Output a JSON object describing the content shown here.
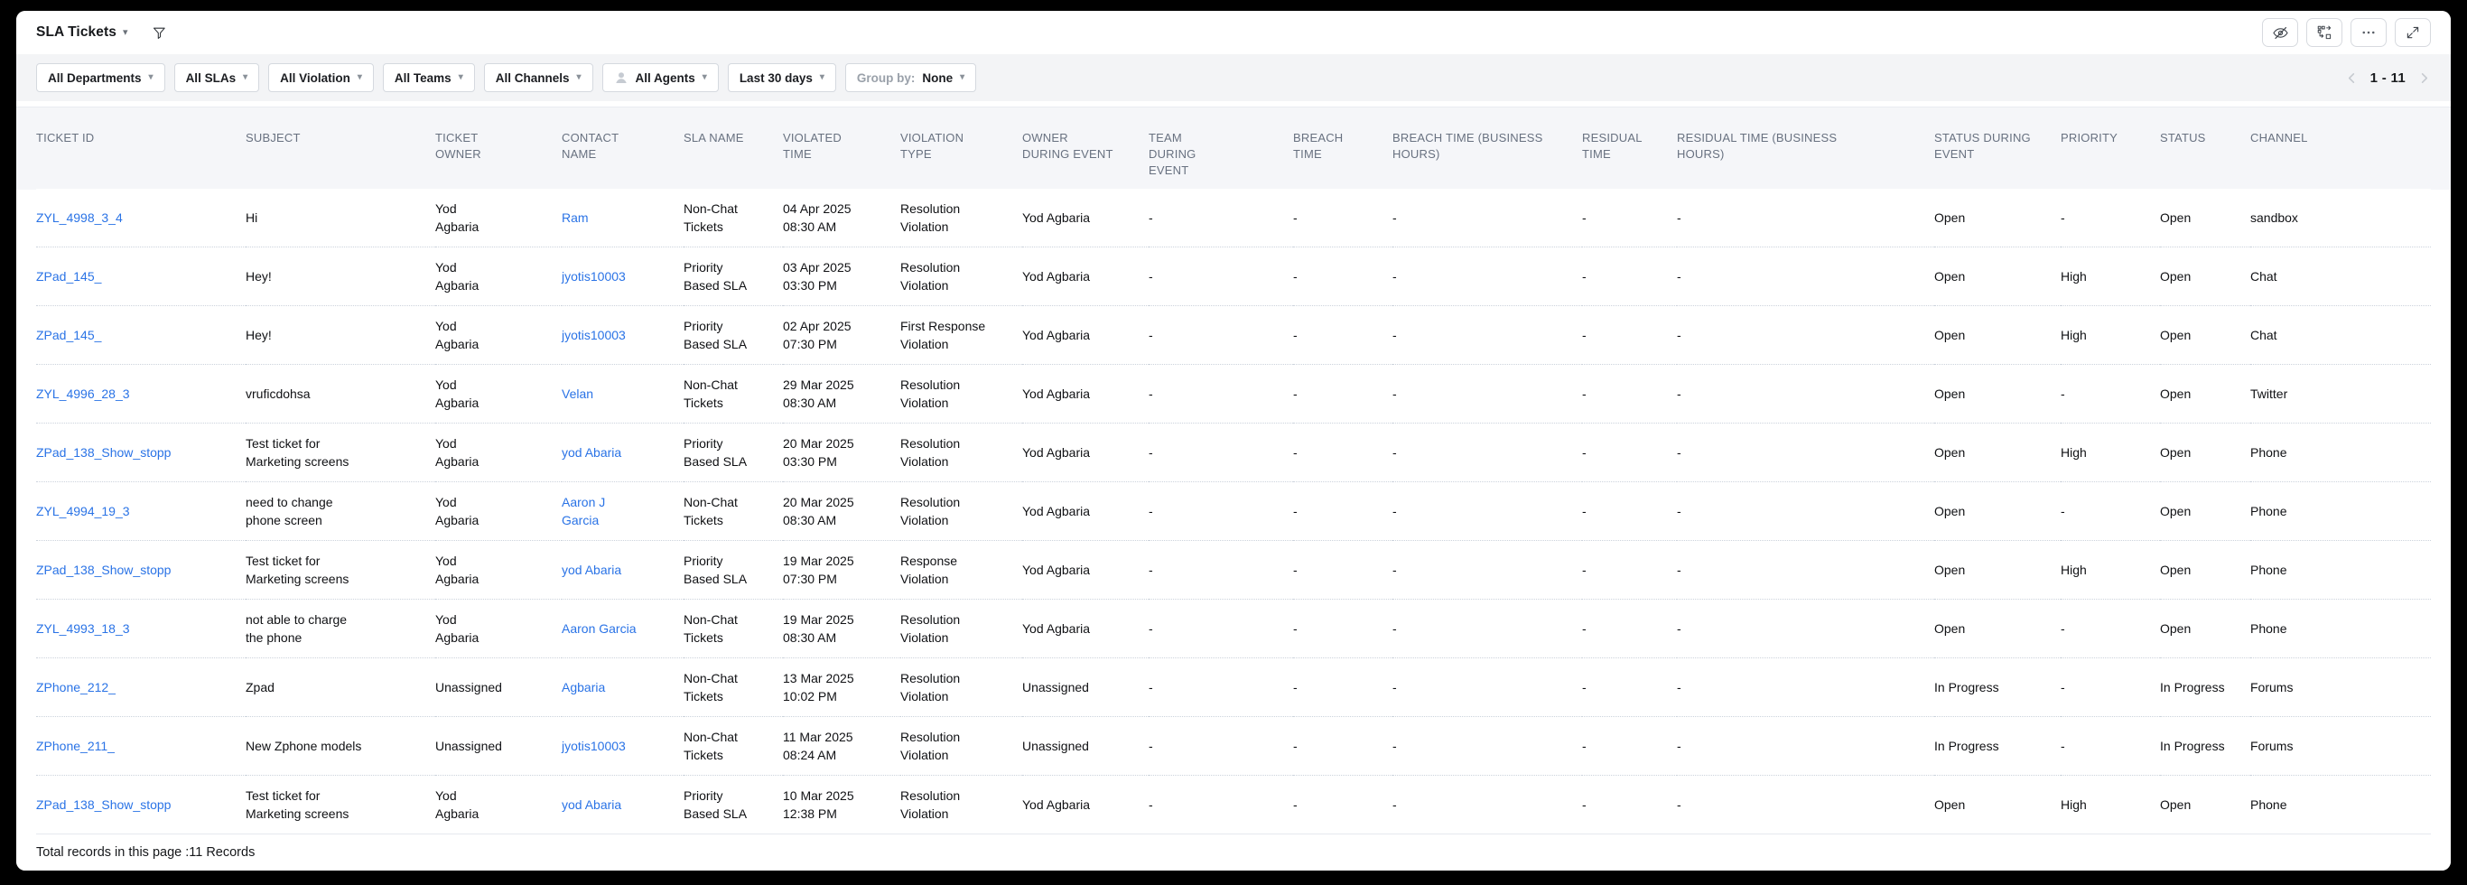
{
  "titlebar": {
    "title": "SLA Tickets"
  },
  "icons": {
    "title_caret": "caret-down-icon",
    "title_filter": "funnel-icon",
    "hide_columns": "eye-off-icon",
    "rearrange": "rearrange-columns-icon",
    "more_options": "ellipsis-icon",
    "expand": "expand-icon",
    "agents": "person-icon",
    "page_prev": "chevron-left-icon",
    "page_next": "chevron-right-icon"
  },
  "filterbar": {
    "filters": [
      {
        "label": "All Departments"
      },
      {
        "label": "All SLAs"
      },
      {
        "label": "All Violation"
      },
      {
        "label": "All Teams"
      },
      {
        "label": "All Channels"
      },
      {
        "label": "All Agents"
      },
      {
        "label": "Last 30 days"
      }
    ],
    "group_by": {
      "label": "Group by:",
      "value": "None"
    },
    "pagination": {
      "range": "1 - 11"
    }
  },
  "table": {
    "columns": [
      "TICKET ID",
      "SUBJECT",
      "TICKET OWNER",
      "CONTACT NAME",
      "SLA NAME",
      "VIOLATED TIME",
      "VIOLATION TYPE",
      "OWNER DURING EVENT",
      "TEAM DURING EVENT",
      "BREACH TIME",
      "BREACH TIME (BUSINESS HOURS)",
      "RESIDUAL TIME",
      "RESIDUAL TIME (BUSINESS HOURS)",
      "STATUS DURING EVENT",
      "PRIORITY",
      "STATUS",
      "CHANNEL"
    ],
    "rows": [
      {
        "ticket_id": "ZYL_4998_3_4",
        "subject": "Hi",
        "ticket_owner": "Yod Agbaria",
        "contact_name": "Ram",
        "sla_name": "Non-Chat Tickets",
        "violated_time": "04 Apr 2025 08:30 AM",
        "violation_type": "Resolution Violation",
        "owner_during_event": "Yod Agbaria",
        "team_during_event": "-",
        "breach_time": "-",
        "breach_time_bh": "-",
        "residual_time": "-",
        "residual_time_bh": "-",
        "status_during_event": "Open",
        "priority": "-",
        "status": "Open",
        "channel": "sandbox"
      },
      {
        "ticket_id": "ZPad_145_",
        "subject": "Hey!",
        "ticket_owner": "Yod Agbaria",
        "contact_name": "jyotis10003",
        "sla_name": "Priority Based SLA",
        "violated_time": "03 Apr 2025 03:30 PM",
        "violation_type": "Resolution Violation",
        "owner_during_event": "Yod Agbaria",
        "team_during_event": "-",
        "breach_time": "-",
        "breach_time_bh": "-",
        "residual_time": "-",
        "residual_time_bh": "-",
        "status_during_event": "Open",
        "priority": "High",
        "status": "Open",
        "channel": "Chat"
      },
      {
        "ticket_id": "ZPad_145_",
        "subject": "Hey!",
        "ticket_owner": "Yod Agbaria",
        "contact_name": "jyotis10003",
        "sla_name": "Priority Based SLA",
        "violated_time": "02 Apr 2025 07:30 PM",
        "violation_type": "First Response Violation",
        "owner_during_event": "Yod Agbaria",
        "team_during_event": "-",
        "breach_time": "-",
        "breach_time_bh": "-",
        "residual_time": "-",
        "residual_time_bh": "-",
        "status_during_event": "Open",
        "priority": "High",
        "status": "Open",
        "channel": "Chat"
      },
      {
        "ticket_id": "ZYL_4996_28_3",
        "subject": "vruficdohsa",
        "ticket_owner": "Yod Agbaria",
        "contact_name": "Velan",
        "sla_name": "Non-Chat Tickets",
        "violated_time": "29 Mar 2025 08:30 AM",
        "violation_type": "Resolution Violation",
        "owner_during_event": "Yod Agbaria",
        "team_during_event": "-",
        "breach_time": "-",
        "breach_time_bh": "-",
        "residual_time": "-",
        "residual_time_bh": "-",
        "status_during_event": "Open",
        "priority": "-",
        "status": "Open",
        "channel": "Twitter"
      },
      {
        "ticket_id": "ZPad_138_Show_stopp",
        "subject": "Test ticket for Marketing screens",
        "ticket_owner": "Yod Agbaria",
        "contact_name": "yod Abaria",
        "sla_name": "Priority Based SLA",
        "violated_time": "20 Mar 2025 03:30 PM",
        "violation_type": "Resolution Violation",
        "owner_during_event": "Yod Agbaria",
        "team_during_event": "-",
        "breach_time": "-",
        "breach_time_bh": "-",
        "residual_time": "-",
        "residual_time_bh": "-",
        "status_during_event": "Open",
        "priority": "High",
        "status": "Open",
        "channel": "Phone"
      },
      {
        "ticket_id": "ZYL_4994_19_3",
        "subject": "need to change phone screen",
        "ticket_owner": "Yod Agbaria",
        "contact_name": "Aaron J Garcia",
        "sla_name": "Non-Chat Tickets",
        "violated_time": "20 Mar 2025 08:30 AM",
        "violation_type": "Resolution Violation",
        "owner_during_event": "Yod Agbaria",
        "team_during_event": "-",
        "breach_time": "-",
        "breach_time_bh": "-",
        "residual_time": "-",
        "residual_time_bh": "-",
        "status_during_event": "Open",
        "priority": "-",
        "status": "Open",
        "channel": "Phone"
      },
      {
        "ticket_id": "ZPad_138_Show_stopp",
        "subject": "Test ticket for Marketing screens",
        "ticket_owner": "Yod Agbaria",
        "contact_name": "yod Abaria",
        "sla_name": "Priority Based SLA",
        "violated_time": "19 Mar 2025 07:30 PM",
        "violation_type": "Response Violation",
        "owner_during_event": "Yod Agbaria",
        "team_during_event": "-",
        "breach_time": "-",
        "breach_time_bh": "-",
        "residual_time": "-",
        "residual_time_bh": "-",
        "status_during_event": "Open",
        "priority": "High",
        "status": "Open",
        "channel": "Phone"
      },
      {
        "ticket_id": "ZYL_4993_18_3",
        "subject": "not able to charge the phone",
        "ticket_owner": "Yod Agbaria",
        "contact_name": "Aaron Garcia",
        "sla_name": "Non-Chat Tickets",
        "violated_time": "19 Mar 2025 08:30 AM",
        "violation_type": "Resolution Violation",
        "owner_during_event": "Yod Agbaria",
        "team_during_event": "-",
        "breach_time": "-",
        "breach_time_bh": "-",
        "residual_time": "-",
        "residual_time_bh": "-",
        "status_during_event": "Open",
        "priority": "-",
        "status": "Open",
        "channel": "Phone"
      },
      {
        "ticket_id": "ZPhone_212_",
        "subject": "Zpad",
        "ticket_owner": "Unassigned",
        "contact_name": "Agbaria",
        "sla_name": "Non-Chat Tickets",
        "violated_time": "13 Mar 2025 10:02 PM",
        "violation_type": "Resolution Violation",
        "owner_during_event": "Unassigned",
        "team_during_event": "-",
        "breach_time": "-",
        "breach_time_bh": "-",
        "residual_time": "-",
        "residual_time_bh": "-",
        "status_during_event": "In Progress",
        "priority": "-",
        "status": "In Progress",
        "channel": "Forums"
      },
      {
        "ticket_id": "ZPhone_211_",
        "subject": "New Zphone models",
        "ticket_owner": "Unassigned",
        "contact_name": "jyotis10003",
        "sla_name": "Non-Chat Tickets",
        "violated_time": "11 Mar 2025 08:24 AM",
        "violation_type": "Resolution Violation",
        "owner_during_event": "Unassigned",
        "team_during_event": "-",
        "breach_time": "-",
        "breach_time_bh": "-",
        "residual_time": "-",
        "residual_time_bh": "-",
        "status_during_event": "In Progress",
        "priority": "-",
        "status": "In Progress",
        "channel": "Forums"
      },
      {
        "ticket_id": "ZPad_138_Show_stopp",
        "subject": "Test ticket for Marketing screens",
        "ticket_owner": "Yod Agbaria",
        "contact_name": "yod Abaria",
        "sla_name": "Priority Based SLA",
        "violated_time": "10 Mar 2025 12:38 PM",
        "violation_type": "Resolution Violation",
        "owner_during_event": "Yod Agbaria",
        "team_during_event": "-",
        "breach_time": "-",
        "breach_time_bh": "-",
        "residual_time": "-",
        "residual_time_bh": "-",
        "status_during_event": "Open",
        "priority": "High",
        "status": "Open",
        "channel": "Phone"
      }
    ]
  },
  "footer": {
    "total_records_text": "Total records in this page :11 Records"
  }
}
